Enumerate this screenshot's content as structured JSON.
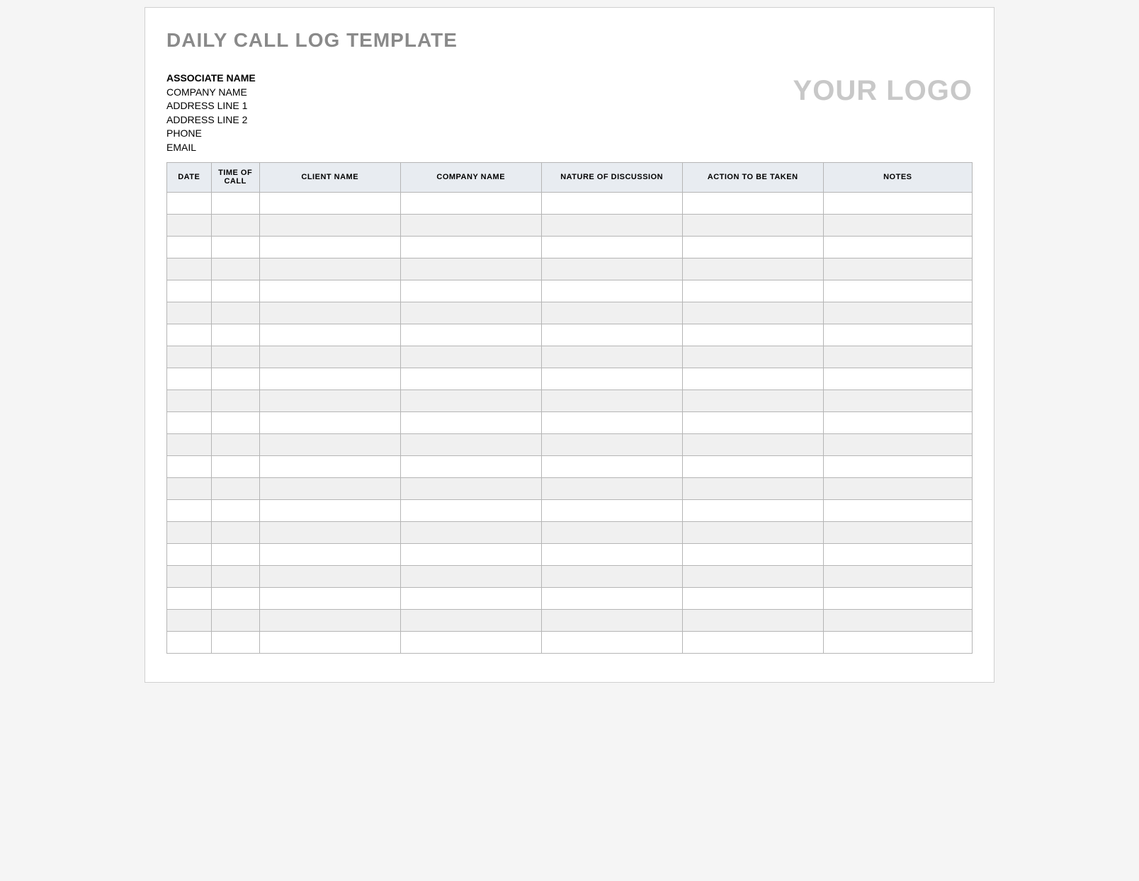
{
  "title": "DAILY CALL LOG TEMPLATE",
  "contact": {
    "associate": "ASSOCIATE NAME",
    "company": "COMPANY NAME",
    "address1": "ADDRESS LINE 1",
    "address2": "ADDRESS LINE 2",
    "phone": "PHONE",
    "email": "EMAIL"
  },
  "logo_placeholder": "YOUR LOGO",
  "table": {
    "headers": {
      "date": "DATE",
      "time": "TIME OF CALL",
      "client": "CLIENT NAME",
      "company": "COMPANY NAME",
      "nature": "NATURE OF DISCUSSION",
      "action": "ACTION TO BE TAKEN",
      "notes": "NOTES"
    },
    "rows": [
      {
        "date": "",
        "time": "",
        "client": "",
        "company": "",
        "nature": "",
        "action": "",
        "notes": ""
      },
      {
        "date": "",
        "time": "",
        "client": "",
        "company": "",
        "nature": "",
        "action": "",
        "notes": ""
      },
      {
        "date": "",
        "time": "",
        "client": "",
        "company": "",
        "nature": "",
        "action": "",
        "notes": ""
      },
      {
        "date": "",
        "time": "",
        "client": "",
        "company": "",
        "nature": "",
        "action": "",
        "notes": ""
      },
      {
        "date": "",
        "time": "",
        "client": "",
        "company": "",
        "nature": "",
        "action": "",
        "notes": ""
      },
      {
        "date": "",
        "time": "",
        "client": "",
        "company": "",
        "nature": "",
        "action": "",
        "notes": ""
      },
      {
        "date": "",
        "time": "",
        "client": "",
        "company": "",
        "nature": "",
        "action": "",
        "notes": ""
      },
      {
        "date": "",
        "time": "",
        "client": "",
        "company": "",
        "nature": "",
        "action": "",
        "notes": ""
      },
      {
        "date": "",
        "time": "",
        "client": "",
        "company": "",
        "nature": "",
        "action": "",
        "notes": ""
      },
      {
        "date": "",
        "time": "",
        "client": "",
        "company": "",
        "nature": "",
        "action": "",
        "notes": ""
      },
      {
        "date": "",
        "time": "",
        "client": "",
        "company": "",
        "nature": "",
        "action": "",
        "notes": ""
      },
      {
        "date": "",
        "time": "",
        "client": "",
        "company": "",
        "nature": "",
        "action": "",
        "notes": ""
      },
      {
        "date": "",
        "time": "",
        "client": "",
        "company": "",
        "nature": "",
        "action": "",
        "notes": ""
      },
      {
        "date": "",
        "time": "",
        "client": "",
        "company": "",
        "nature": "",
        "action": "",
        "notes": ""
      },
      {
        "date": "",
        "time": "",
        "client": "",
        "company": "",
        "nature": "",
        "action": "",
        "notes": ""
      },
      {
        "date": "",
        "time": "",
        "client": "",
        "company": "",
        "nature": "",
        "action": "",
        "notes": ""
      },
      {
        "date": "",
        "time": "",
        "client": "",
        "company": "",
        "nature": "",
        "action": "",
        "notes": ""
      },
      {
        "date": "",
        "time": "",
        "client": "",
        "company": "",
        "nature": "",
        "action": "",
        "notes": ""
      },
      {
        "date": "",
        "time": "",
        "client": "",
        "company": "",
        "nature": "",
        "action": "",
        "notes": ""
      },
      {
        "date": "",
        "time": "",
        "client": "",
        "company": "",
        "nature": "",
        "action": "",
        "notes": ""
      },
      {
        "date": "",
        "time": "",
        "client": "",
        "company": "",
        "nature": "",
        "action": "",
        "notes": ""
      }
    ]
  }
}
